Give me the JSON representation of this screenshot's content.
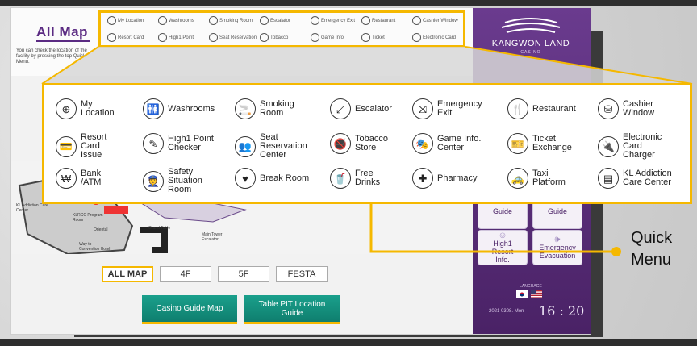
{
  "header": {
    "title": "All Map",
    "hint": "You can check the location of the facility by pressing the top Quick Menu."
  },
  "mini_menu": [
    {
      "label": "My Location",
      "icon": "location-icon"
    },
    {
      "label": "Washrooms",
      "icon": "washroom-icon"
    },
    {
      "label": "Smoking Room",
      "icon": "smoking-icon"
    },
    {
      "label": "Escalator",
      "icon": "escalator-icon"
    },
    {
      "label": "Emergency Exit",
      "icon": "exit-icon"
    },
    {
      "label": "Restaurant",
      "icon": "restaurant-icon"
    },
    {
      "label": "Cashier Window",
      "icon": "cashier-icon"
    },
    {
      "label": "Resort Card",
      "icon": "card-icon"
    },
    {
      "label": "High1 Point",
      "icon": "point-icon"
    },
    {
      "label": "Seat Reservation",
      "icon": "seat-icon"
    },
    {
      "label": "Tobacco",
      "icon": "tobacco-icon"
    },
    {
      "label": "Game Info",
      "icon": "game-icon"
    },
    {
      "label": "Ticket",
      "icon": "ticket-icon"
    },
    {
      "label": "Electronic Card",
      "icon": "charger-icon"
    }
  ],
  "quick_menu": [
    {
      "label": "My\nLocation",
      "icon": "location-icon",
      "glyph": "⊕"
    },
    {
      "label": "Washrooms",
      "icon": "washroom-icon",
      "glyph": "🚻"
    },
    {
      "label": "Smoking\nRoom",
      "icon": "smoking-icon",
      "glyph": "🚬"
    },
    {
      "label": "Escalator",
      "icon": "escalator-icon",
      "glyph": "⤢"
    },
    {
      "label": "Emergency\nExit",
      "icon": "exit-icon",
      "glyph": "⛝"
    },
    {
      "label": "Restaurant",
      "icon": "restaurant-icon",
      "glyph": "🍴"
    },
    {
      "label": "Cashier\nWindow",
      "icon": "cashier-icon",
      "glyph": "⛁"
    },
    {
      "label": "Resort\nCard\nIssue",
      "icon": "card-icon",
      "glyph": "💳"
    },
    {
      "label": "High1 Point\nChecker",
      "icon": "point-icon",
      "glyph": "✎"
    },
    {
      "label": "Seat\nReservation\nCenter",
      "icon": "seat-icon",
      "glyph": "👥"
    },
    {
      "label": "Tobacco\nStore",
      "icon": "tobacco-icon",
      "glyph": "🚭"
    },
    {
      "label": "Game Info.\nCenter",
      "icon": "game-icon",
      "glyph": "🎭"
    },
    {
      "label": "Ticket\nExchange",
      "icon": "ticket-icon",
      "glyph": "🎫"
    },
    {
      "label": "Electronic\nCard\nCharger",
      "icon": "charger-icon",
      "glyph": "🔌"
    },
    {
      "label": "Bank\n/ATM",
      "icon": "bank-icon",
      "glyph": "₩"
    },
    {
      "label": "Safety\nSituation\nRoom",
      "icon": "safety-icon",
      "glyph": "👮"
    },
    {
      "label": "Break Room",
      "icon": "break-room-icon",
      "glyph": "♥"
    },
    {
      "label": "Free\nDrinks",
      "icon": "drinks-icon",
      "glyph": "🥤"
    },
    {
      "label": "Pharmacy",
      "icon": "pharmacy-icon",
      "glyph": "✚"
    },
    {
      "label": "Taxi\nPlatform",
      "icon": "taxi-icon",
      "glyph": "🚕"
    },
    {
      "label": "KL Addiction\nCare Center",
      "icon": "care-icon",
      "glyph": "▤"
    }
  ],
  "map": {
    "labels": [
      "KL Addiction Care Center",
      "KLRCC Program Room",
      "Main Tower Escalator",
      "Grand Table",
      "Oriental",
      "Way to Convention Hotel"
    ]
  },
  "floor_tabs": [
    {
      "label": "ALL MAP",
      "active": true
    },
    {
      "label": "4F",
      "active": false
    },
    {
      "label": "5F",
      "active": false
    },
    {
      "label": "FESTA",
      "active": false
    }
  ],
  "guide_buttons": {
    "casino_map": "Casino Guide Map",
    "table_pit": "Table PIT Location Guide"
  },
  "sidebar": {
    "brand": "KANGWON LAND",
    "brand_sub": "CASINO",
    "buttons": [
      {
        "label": "Guide",
        "icon": "guide-icon"
      },
      {
        "label": "Guide",
        "icon": "guide-icon"
      },
      {
        "label": "High1\nResort\nInfo.",
        "icon": "person-icon"
      },
      {
        "label": "Emergency\nEvacuation",
        "icon": "speaker-icon"
      }
    ],
    "language_label": "LANGUAGE",
    "date": "2021 0308. Mon",
    "time": "16 : 20"
  },
  "callout": {
    "label_line1": "Quick",
    "label_line2": "Menu"
  },
  "colors": {
    "accent": "#f5b800",
    "brand_purple": "#5a2a82",
    "button_teal": "#12907d"
  }
}
